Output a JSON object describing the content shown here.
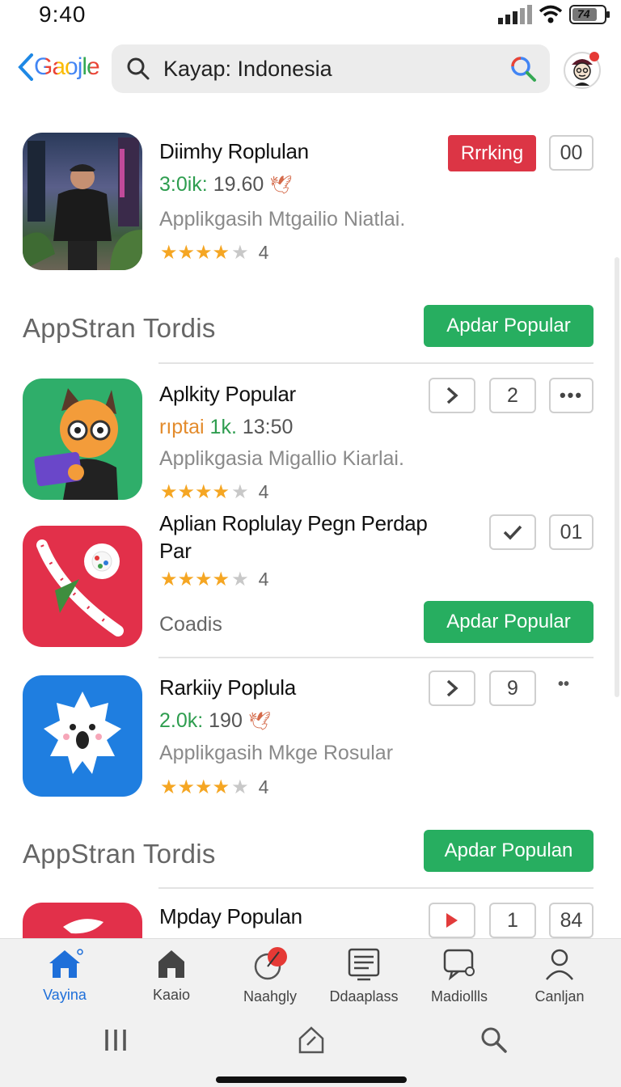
{
  "status": {
    "time": "9:40",
    "battery_label": "74"
  },
  "header": {
    "back_logo": "Gaojle",
    "search_text": "Kayap: Indonesia"
  },
  "featured": {
    "title": "Diimhy Roplulan",
    "meta_green": "3:0ik:",
    "meta_rest": "19.60",
    "subtitle": "Applikgasih Mtgailio Niatlai.",
    "rating": "4",
    "rank_button": "Rrrking",
    "count_button": "00"
  },
  "sections": [
    {
      "title": "AppStran Tordis",
      "button": "Apdar Popular"
    },
    {
      "title": "AppStran Tordis",
      "button": "Apdar Populan"
    }
  ],
  "apps": [
    {
      "title": "Aplkity Popular",
      "meta_orange": "rıptai",
      "meta_green": "1k.",
      "meta_rest": "13:50",
      "subtitle": "Applikgasia Migallio Kiarlai.",
      "rating": "4",
      "buttons": [
        "2"
      ]
    },
    {
      "title_line1": "Aplian Roplulay Pegn Perdap",
      "title_line2": "Par",
      "rating": "4",
      "caption": "Coadis",
      "count_button": "01",
      "green_button": "Apdar Popular"
    },
    {
      "title": "Rarkiiy Poplula",
      "meta_green": "2.0k:",
      "meta_rest": "190",
      "subtitle": "Applikgasih Mkge Rosular",
      "rating": "4",
      "count_button": "9"
    },
    {
      "title": "Mpday Populan",
      "count_button": "1",
      "count_button2": "84"
    }
  ],
  "tabs": [
    {
      "label": "Vayina",
      "active": true
    },
    {
      "label": "Kaaio"
    },
    {
      "label": "Naahgly"
    },
    {
      "label": "Ddaaplass"
    },
    {
      "label": "Madiollls"
    },
    {
      "label": "Canljan"
    }
  ],
  "colors": {
    "green": "#27ae60",
    "red": "#dc3545",
    "blue_active": "#1e6fd9",
    "star": "#f5a623"
  }
}
